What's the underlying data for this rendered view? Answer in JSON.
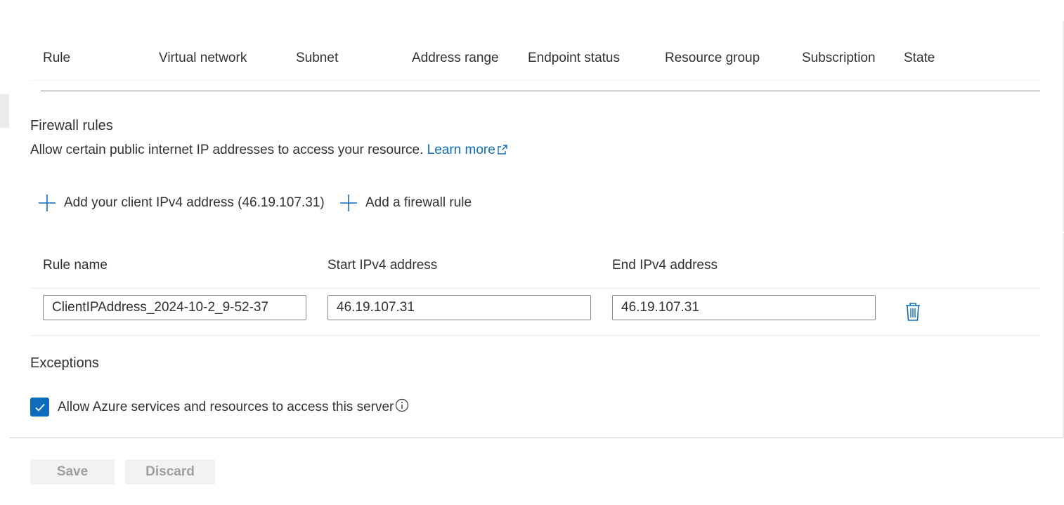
{
  "vnet_table": {
    "columns": [
      "Rule",
      "Virtual network",
      "Subnet",
      "Address range",
      "Endpoint status",
      "Resource group",
      "Subscription",
      "State"
    ]
  },
  "firewall": {
    "title": "Firewall rules",
    "description": "Allow certain public internet IP addresses to access your resource.",
    "learn_more": "Learn more",
    "add_client_label": "Add your client IPv4 address (46.19.107.31)",
    "add_rule_label": "Add a firewall rule",
    "columns": {
      "rule_name": "Rule name",
      "start_ip": "Start IPv4 address",
      "end_ip": "End IPv4 address"
    },
    "rows": [
      {
        "rule_name": "ClientIPAddress_2024-10-2_9-52-37",
        "start_ip": "46.19.107.31",
        "end_ip": "46.19.107.31"
      }
    ]
  },
  "exceptions": {
    "title": "Exceptions",
    "allow_azure_label": "Allow Azure services and resources to access this server",
    "allow_azure_checked": true
  },
  "footer": {
    "save_label": "Save",
    "discard_label": "Discard"
  },
  "colors": {
    "accent": "#0f6cbd",
    "text": "#323130",
    "disabled_text": "#a19f9d",
    "disabled_bg": "#f3f2f1"
  },
  "icons": {
    "add": "plus-icon",
    "delete": "trash-icon",
    "external_link": "external-link-icon",
    "info": "info-icon",
    "checkbox": "checkmark-icon"
  }
}
